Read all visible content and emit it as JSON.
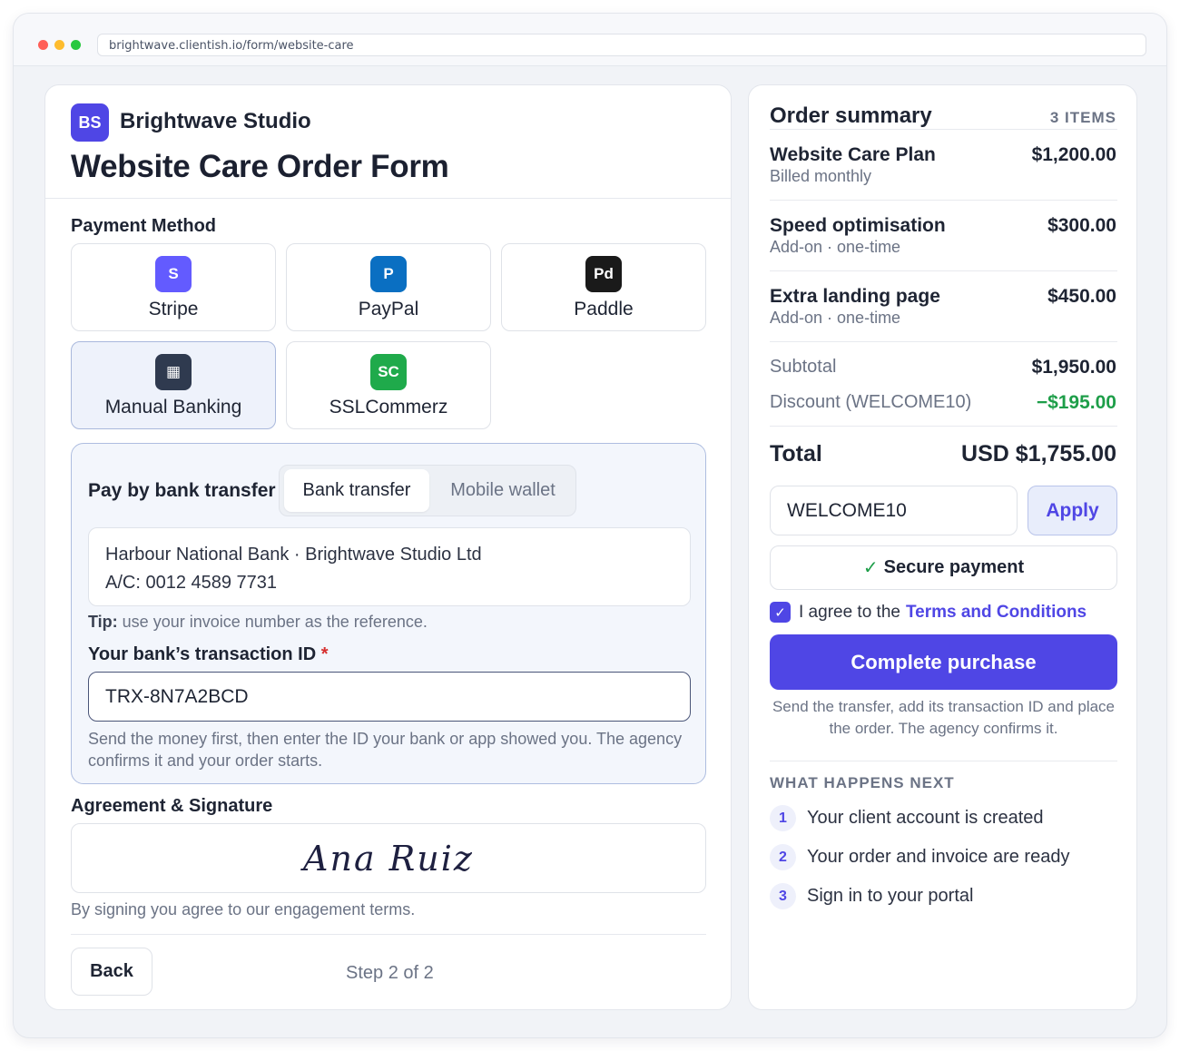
{
  "browser": {
    "url": "brightwave.clientish.io/form/website-care"
  },
  "brand": {
    "initials": "BS",
    "name": "Brightwave Studio"
  },
  "form": {
    "title": "Website Care Order Form"
  },
  "payment": {
    "label": "Payment Method",
    "methods": [
      {
        "icon": "S",
        "name": "Stripe",
        "color": "#635bff"
      },
      {
        "icon": "P",
        "name": "PayPal",
        "color": "#0a6fc2"
      },
      {
        "icon": "Pd",
        "name": "Paddle",
        "color": "#1a1a1a"
      },
      {
        "icon": "▦",
        "name": "Manual Banking",
        "color": "#2f3a4f",
        "selected": true
      },
      {
        "icon": "SC",
        "name": "SSLCommerz",
        "color": "#1faa4b"
      }
    ]
  },
  "bank": {
    "title": "Pay by bank transfer",
    "tabs": [
      "Bank transfer",
      "Mobile wallet"
    ],
    "active_tab": "Bank transfer",
    "details_line1": "Harbour National Bank · Brightwave Studio Ltd",
    "details_line2": "A/C: 0012 4589 7731",
    "tip_label": "Tip:",
    "tip_text": " use your invoice number as the reference.",
    "txn_label": "Your bank’s transaction ID",
    "txn_required": "*",
    "txn_value": "TRX-8N7A2BCD",
    "txn_help": "Send the money first, then enter the ID your bank or app showed you. The agency confirms it and your order starts."
  },
  "agreement": {
    "label": "Agreement & Signature",
    "signature": "Ana Ruiz",
    "help": "By signing you agree to our engagement terms."
  },
  "footer": {
    "back_label": "Back",
    "step": "Step 2 of 2"
  },
  "summary": {
    "title": "Order summary",
    "count": "3 ITEMS",
    "items": [
      {
        "name": "Website Care Plan",
        "sub": "Billed monthly",
        "price": "$1,200.00"
      },
      {
        "name": "Speed optimisation",
        "sub": "Add-on · one-time",
        "price": "$300.00"
      },
      {
        "name": "Extra landing page",
        "sub": "Add-on · one-time",
        "price": "$450.00"
      }
    ],
    "subtotal_label": "Subtotal",
    "subtotal_value": "$1,950.00",
    "discount_label": "Discount (WELCOME10)",
    "discount_value": "−$195.00",
    "total_label": "Total",
    "total_value": "USD $1,755.00",
    "coupon_value": "WELCOME10",
    "apply_label": "Apply",
    "secure_label": "Secure payment",
    "agree_text": "I agree to the",
    "terms_link": "Terms and Conditions",
    "cta_label": "Complete purchase",
    "cta_help": "Send the transfer, add its transaction ID and place the order. The agency confirms it.",
    "next_title": "WHAT HAPPENS NEXT",
    "next_steps": [
      {
        "num": "1",
        "text": "Your client account is created"
      },
      {
        "num": "2",
        "text": "Your order and invoice are ready"
      },
      {
        "num": "3",
        "text": "Sign in to your portal"
      }
    ]
  },
  "colors": {
    "accent": "#4f46e5",
    "success": "#1e9e49",
    "danger": "#d62f2f"
  }
}
